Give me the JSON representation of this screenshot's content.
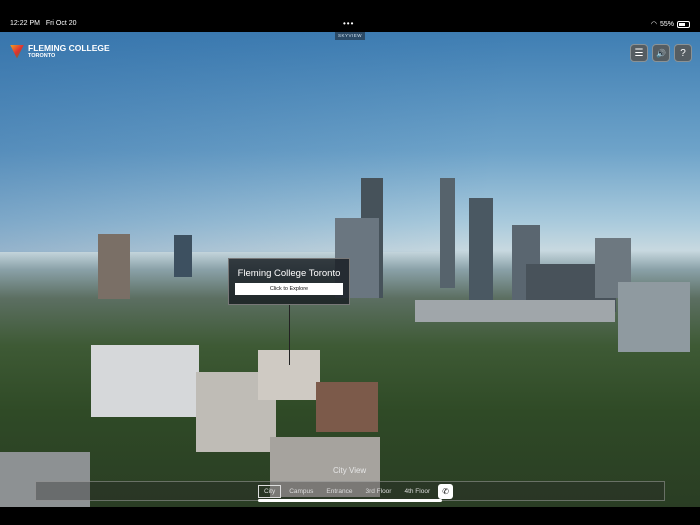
{
  "status_bar": {
    "time": "12:22 PM",
    "date": "Fri Oct 20",
    "battery": "55%",
    "battery_level": 0.55
  },
  "app": {
    "tag": "SKYVIEW",
    "logo_line1": "FLEMING COLLEGE",
    "logo_line2": "TORONTO"
  },
  "toolbar": [
    {
      "icon": "list-icon",
      "glyph": "☰"
    },
    {
      "icon": "speaker-icon",
      "glyph": "🔊"
    },
    {
      "icon": "help-icon",
      "glyph": "?"
    }
  ],
  "hotspot": {
    "title": "Fleming College Toronto",
    "button": "Click to Explore"
  },
  "view_label": "City View",
  "nav": {
    "items": [
      "City",
      "Campus",
      "Entrance",
      "3rd Floor",
      "4th Floor"
    ],
    "active": "City",
    "call_glyph": "✆"
  }
}
